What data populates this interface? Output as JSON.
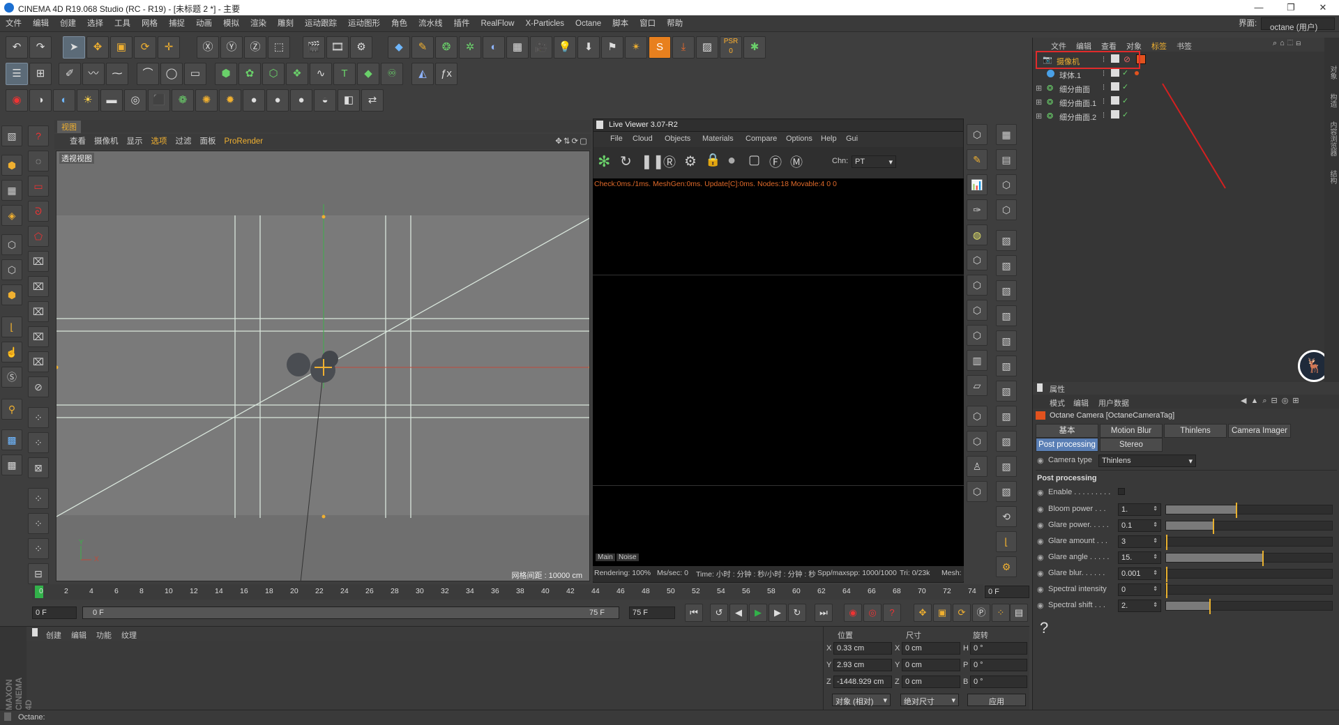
{
  "window": {
    "title": "CINEMA 4D R19.068 Studio (RC - R19) - [未标题 2 *] - 主要"
  },
  "menu": [
    "文件",
    "编辑",
    "创建",
    "选择",
    "工具",
    "网格",
    "捕捉",
    "动画",
    "模拟",
    "渲染",
    "雕刻",
    "运动跟踪",
    "运动图形",
    "角色",
    "流水线",
    "插件",
    "RealFlow",
    "X-Particles",
    "Octane",
    "脚本",
    "窗口",
    "帮助"
  ],
  "interface": {
    "label": "界面:",
    "value": "octane (用户)"
  },
  "viewport": {
    "menu": [
      "查看",
      "摄像机",
      "显示",
      "选项",
      "过滤",
      "面板",
      "ProRender"
    ],
    "tab": "视图",
    "name": "透视视图",
    "grid_label": "网格间距 : 10000 cm",
    "axis_y": "Y",
    "axis_x": "X"
  },
  "live_viewer": {
    "title": "Live Viewer 3.07-R2",
    "menu": [
      "File",
      "Cloud",
      "Objects",
      "Materials",
      "Compare",
      "Options",
      "Help",
      "Gui"
    ],
    "chn_label": "Chn:",
    "chn_value": "PT",
    "status": "Check:0ms./1ms. MeshGen:0ms. Update[C]:0ms. Nodes:18 Movable:4  0 0",
    "tabs": [
      "Main",
      "Noise"
    ],
    "rendering": "Rendering: 100%",
    "ms_sec": "Ms/sec: 0",
    "time": "Time: 小时 : 分钟 : 秒/小时 : 分钟 : 秒",
    "spp": "Spp/maxspp: 1000/1000",
    "tri": "Tri: 0/23k",
    "mesh": "Mesh:"
  },
  "object_manager": {
    "tabs": [
      "文件",
      "编辑",
      "查看",
      "对象",
      "标签",
      "书签"
    ],
    "objects": [
      {
        "name": "摄像机",
        "icon": "camera-icon"
      },
      {
        "name": "球体.1",
        "icon": "sphere-icon"
      },
      {
        "name": "细分曲面",
        "icon": "subdivision-icon"
      },
      {
        "name": "细分曲面.1",
        "icon": "subdivision-icon"
      },
      {
        "name": "细分曲面.2",
        "icon": "subdivision-icon"
      }
    ],
    "side_tabs": [
      "对象",
      "构造",
      "内容浏览器",
      "结构"
    ]
  },
  "attributes": {
    "title": "属性",
    "menu": [
      "模式",
      "编辑",
      "用户数据"
    ],
    "header": "Octane Camera [OctaneCameraTag]",
    "tabs_row1": [
      "基本",
      "Motion Blur",
      "Thinlens",
      "Camera Imager"
    ],
    "tabs_row2": [
      "Post processing",
      "Stereo"
    ],
    "camera_type_label": "Camera type",
    "camera_type_value": "Thinlens",
    "section": "Post processing",
    "enable_label": "Enable . . . . . . . . .",
    "params": [
      {
        "label": "Bloom power . . .",
        "value": "1.",
        "fraction": 0.42
      },
      {
        "label": "Glare power. . . . .",
        "value": "0.1",
        "fraction": 0.28
      },
      {
        "label": "Glare amount . . .",
        "value": "3",
        "fraction": 0
      },
      {
        "label": "Glare angle . . . . .",
        "value": "15.",
        "fraction": 0.58
      },
      {
        "label": "Glare blur. . . . . .",
        "value": "0.001",
        "fraction": 0.0
      },
      {
        "label": "Spectral intensity",
        "value": "0",
        "fraction": 0
      },
      {
        "label": "Spectral shift . . .",
        "value": "2.",
        "fraction": 0.26
      }
    ]
  },
  "timeline": {
    "ticks": [
      "0",
      "2",
      "4",
      "6",
      "8",
      "10",
      "12",
      "14",
      "16",
      "18",
      "20",
      "22",
      "24",
      "26",
      "28",
      "30",
      "32",
      "34",
      "36",
      "38",
      "40",
      "42",
      "44",
      "46",
      "48",
      "50",
      "52",
      "54",
      "56",
      "58",
      "60",
      "62",
      "64",
      "66",
      "68",
      "70",
      "72",
      "74"
    ],
    "frame_right": "0 F",
    "start": "0 F",
    "range_start": "0 F",
    "range_end": "75 F",
    "end": "75 F"
  },
  "material_panel": {
    "menu": [
      "创建",
      "编辑",
      "功能",
      "纹理"
    ],
    "brand": "MAXON CINEMA 4D"
  },
  "coords": {
    "headers": [
      "位置",
      "尺寸",
      "旋转"
    ],
    "rows": [
      {
        "axis": "X",
        "pos": "0.33 cm",
        "size_axis": "X",
        "size": "0 cm",
        "rot_axis": "H",
        "rot": "0 °"
      },
      {
        "axis": "Y",
        "pos": "2.93 cm",
        "size_axis": "Y",
        "size": "0 cm",
        "rot_axis": "P",
        "rot": "0 °"
      },
      {
        "axis": "Z",
        "pos": "-1448.929 cm",
        "size_axis": "Z",
        "size": "0 cm",
        "rot_axis": "B",
        "rot": "0 °"
      }
    ],
    "mode1": "对象 (相对)",
    "mode2": "绝对尺寸",
    "apply": "应用"
  },
  "status": "Octane:"
}
